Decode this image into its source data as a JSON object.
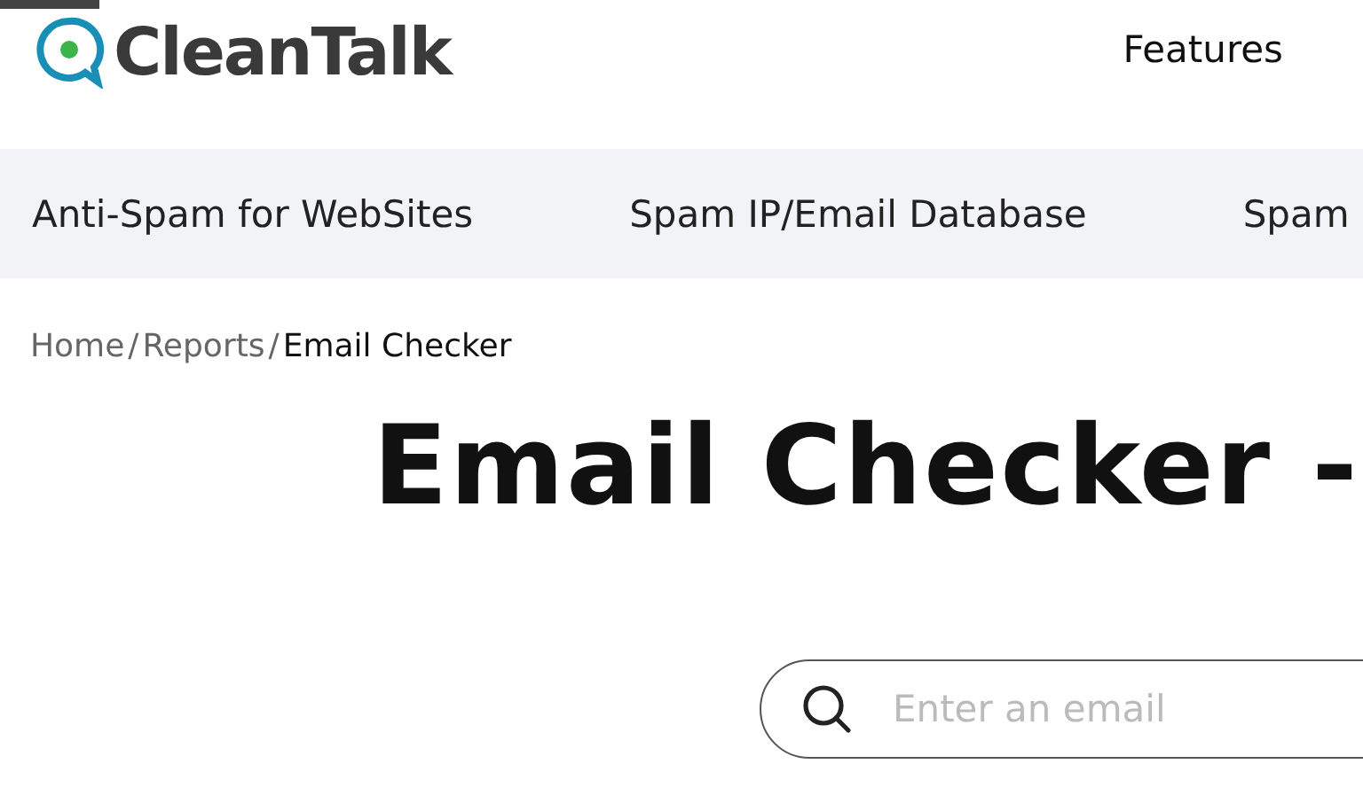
{
  "header": {
    "logo": "CleanTalk",
    "menu": [
      "Features"
    ]
  },
  "nav": [
    "Anti-Spam for WebSites",
    "Spam IP/Email Database",
    "Spam"
  ],
  "breadcrumb_separator": "/",
  "breadcrumb": [
    {
      "label": "Home",
      "current": false
    },
    {
      "label": "Reports",
      "current": false
    },
    {
      "label": "Email Checker",
      "current": true
    }
  ],
  "title": "Email Checker -",
  "search": {
    "placeholder": "Enter an email"
  }
}
